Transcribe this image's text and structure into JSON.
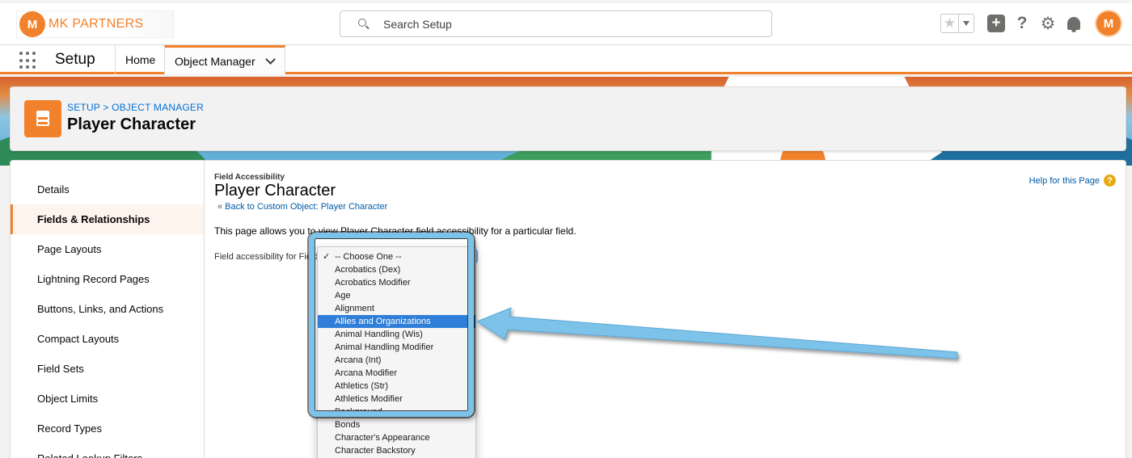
{
  "org": {
    "logo_mark": "M",
    "name": "MK PARTNERS"
  },
  "search": {
    "placeholder": "Search Setup"
  },
  "header_icons": {
    "star": "star-icon",
    "dropdown": "chevron-down-icon",
    "add": "plus-icon",
    "help": "question-icon",
    "settings": "gear-icon",
    "notifications": "bell-icon",
    "avatar_mark": "M"
  },
  "context_bar": {
    "app_name": "Setup",
    "home_label": "Home",
    "object_manager_label": "Object Manager"
  },
  "page_header": {
    "breadcrumb": "SETUP > OBJECT MANAGER",
    "title": "Player Character"
  },
  "sidebar": {
    "items": [
      {
        "label": "Details"
      },
      {
        "label": "Fields & Relationships"
      },
      {
        "label": "Page Layouts"
      },
      {
        "label": "Lightning Record Pages"
      },
      {
        "label": "Buttons, Links, and Actions"
      },
      {
        "label": "Compact Layouts"
      },
      {
        "label": "Field Sets"
      },
      {
        "label": "Object Limits"
      },
      {
        "label": "Record Types"
      },
      {
        "label": "Related Lookup Filters"
      }
    ]
  },
  "content": {
    "section_label": "Field Accessibility",
    "title": "Player Character",
    "back_arrow": "«",
    "back_link": "Back to Custom Object: Player Character",
    "description": "This page allows you to view Player Character field accessibility for a particular field.",
    "field_label": "Field accessibility for Field:",
    "help_link": "Help for this Page",
    "help_mark": "?"
  },
  "dropdown": {
    "options": [
      "-- Choose One --",
      "Acrobatics (Dex)",
      "Acrobatics Modifier",
      "Age",
      "Alignment",
      "Allies and Organizations",
      "Animal Handling (Wis)",
      "Animal Handling Modifier",
      "Arcana (Int)",
      "Arcana Modifier",
      "Athletics (Str)",
      "Athletics Modifier",
      "Background",
      "Bonds",
      "Character's Appearance",
      "Character Backstory"
    ],
    "checked_index": 0,
    "selected_index": 5
  },
  "colors": {
    "brand_orange": "#f2812b",
    "link_blue": "#015ba7",
    "highlight_blue": "#7dc3e9",
    "selected_row": "#2f7fd8"
  }
}
